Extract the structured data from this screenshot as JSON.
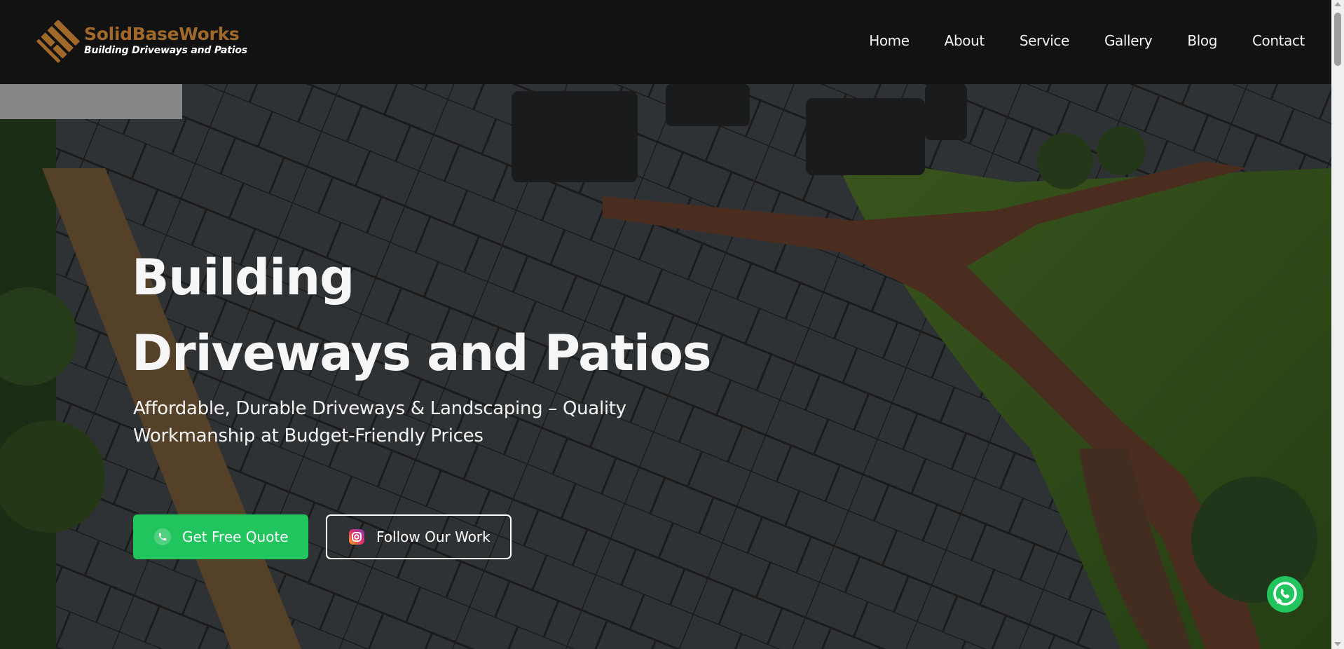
{
  "brand": {
    "name": "SolidBaseWorks",
    "tagline": "Building Driveways and Patios",
    "color": "#a0692a"
  },
  "nav": {
    "items": [
      "Home",
      "About",
      "Service",
      "Gallery",
      "Blog",
      "Contact"
    ]
  },
  "hero": {
    "title_line1": "Building",
    "title_line2": "Driveways and Patios",
    "subtitle": "Affordable, Durable Driveways & Landscaping – Quality Workmanship at Budget-Friendly Prices",
    "cta_primary": "Get Free Quote",
    "cta_secondary": "Follow Our Work"
  },
  "icons": {
    "phone": "phone-icon",
    "instagram": "instagram-icon",
    "whatsapp": "whatsapp-icon"
  },
  "colors": {
    "primary_button": "#21c45d",
    "header_bg": "#121212"
  }
}
